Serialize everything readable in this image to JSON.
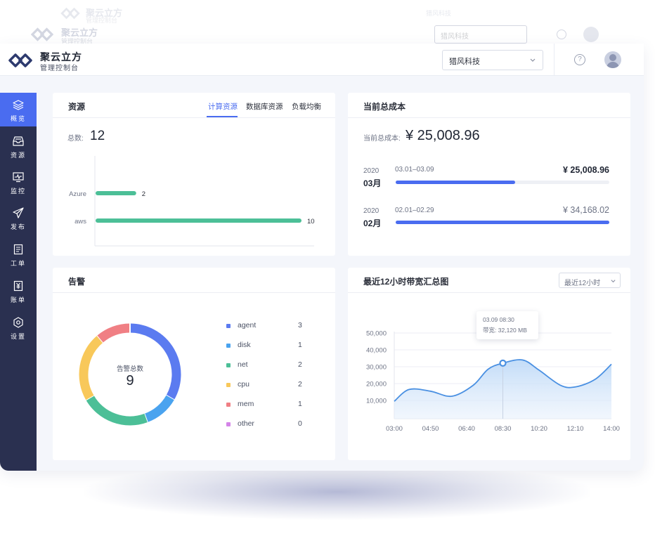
{
  "brand": {
    "title": "聚云立方",
    "subtitle": "管理控制台"
  },
  "topbar": {
    "org_value": "猎风科技",
    "help_glyph": "?"
  },
  "colors": {
    "accent": "#4a6cf0",
    "sidebar": "#2a3050",
    "green": "#4cbf97"
  },
  "sidebar": {
    "items": [
      {
        "label": "概览",
        "icon": "layers-icon",
        "active": true
      },
      {
        "label": "资源",
        "icon": "inbox-icon",
        "active": false
      },
      {
        "label": "监控",
        "icon": "monitor-icon",
        "active": false
      },
      {
        "label": "发布",
        "icon": "send-icon",
        "active": false
      },
      {
        "label": "工单",
        "icon": "clipboard-icon",
        "active": false
      },
      {
        "label": "账单",
        "icon": "bill-icon",
        "active": false
      },
      {
        "label": "设置",
        "icon": "settings-icon",
        "active": false
      }
    ]
  },
  "resources": {
    "title": "资源",
    "tabs": [
      "计算资源",
      "数据库资源",
      "负载均衡"
    ],
    "total_label": "总数:",
    "total_value": "12"
  },
  "cost": {
    "title": "当前总成本",
    "current_label": "当前总成本:",
    "current_value": "¥ 25,008.96",
    "periods": [
      {
        "year": "2020",
        "month": "03月",
        "range": "03.01–03.09",
        "amount": "¥ 25,008.96",
        "progress": 0.56
      },
      {
        "year": "2020",
        "month": "02月",
        "range": "02.01–02.29",
        "amount": "¥ 34,168.02",
        "progress": 1.0
      }
    ]
  },
  "alerts": {
    "title": "告警",
    "center_label": "告警总数",
    "center_value": "9"
  },
  "bandwidth": {
    "title": "最近12小时带宽汇总图",
    "range_select": "最近12小时",
    "tooltip": {
      "time": "03.09 08:30",
      "label": "带宽:",
      "value": "32,120 MB"
    }
  },
  "chart_data": [
    {
      "type": "bar",
      "orientation": "horizontal",
      "categories": [
        "Azure",
        "aws"
      ],
      "values": [
        2,
        10
      ],
      "xlim": [
        0,
        10
      ],
      "xticks": [
        "0",
        "2",
        "4",
        "6",
        "8",
        "10"
      ],
      "color": "#4cbf97"
    },
    {
      "type": "pie",
      "donut": true,
      "labels": [
        "agent",
        "disk",
        "net",
        "cpu",
        "mem",
        "other"
      ],
      "values": [
        3,
        1,
        2,
        2,
        1,
        0
      ],
      "colors": [
        "#5b7bf0",
        "#4aa3ef",
        "#4cbf97",
        "#f8c85a",
        "#f07f84",
        "#d484e8"
      ],
      "legend": "right"
    },
    {
      "type": "area",
      "x": [
        "03:00",
        "04:50",
        "06:40",
        "08:30",
        "10:20",
        "12:10",
        "14:00"
      ],
      "xticks": [
        "03:00",
        "04:50",
        "06:40",
        "08:30",
        "10:20",
        "12:10",
        "14:00"
      ],
      "yticks": [
        "50,000",
        "40,000",
        "30,000",
        "20,000",
        "10,000"
      ],
      "ylim": [
        0,
        50000
      ],
      "series": [
        {
          "x_hours": [
            3.0,
            3.75,
            4.83,
            5.92,
            7.0,
            7.75,
            8.5,
            9.5,
            10.33,
            11.42,
            12.17,
            13.17,
            14.0
          ],
          "values": [
            9500,
            16500,
            15500,
            12500,
            19000,
            28500,
            32120,
            34000,
            28000,
            19000,
            18000,
            22500,
            31500
          ]
        }
      ],
      "color": "#4a90e2",
      "highlight": {
        "x_hours": 8.5,
        "value": 32120
      },
      "grid": true
    }
  ]
}
